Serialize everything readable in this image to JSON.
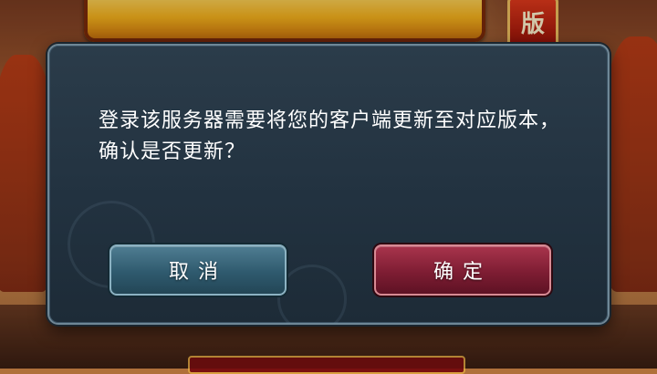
{
  "game": {
    "edition_badge": "版"
  },
  "dialog": {
    "message": "登录该服务器需要将您的客户端更新至对应版本，确认是否更新？",
    "cancel_label": "取消",
    "confirm_label": "确定"
  },
  "colors": {
    "dialog_bg": "#223240",
    "dialog_border": "#6f8796",
    "cancel_button": "#2f5a6e",
    "confirm_button": "#7e1d33",
    "text": "#ffffff"
  }
}
